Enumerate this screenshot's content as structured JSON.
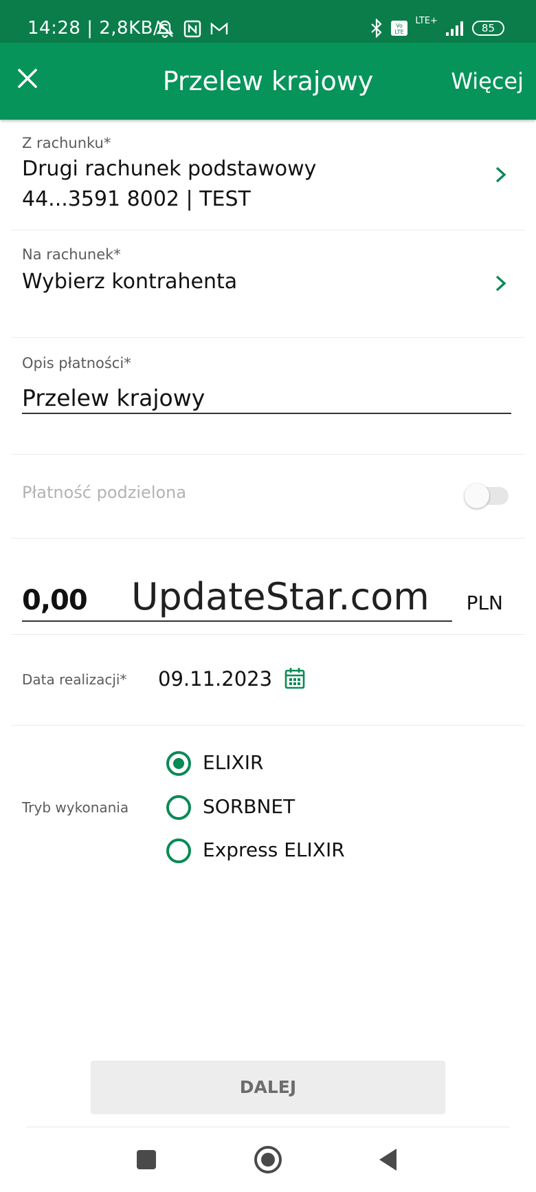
{
  "status_bar": {
    "time_speed": "14:28 | 2,8KB/s",
    "battery": "85",
    "network": "LTE+"
  },
  "app_bar": {
    "title": "Przelew krajowy",
    "more_label": "Więcej"
  },
  "from_account": {
    "label": "Z rachunku*",
    "name": "Drugi rachunek podstawowy",
    "number": "44...3591 8002 | TEST"
  },
  "to_account": {
    "label": "Na rachunek*",
    "value": "Wybierz kontrahenta"
  },
  "description": {
    "label": "Opis płatności*",
    "value": "Przelew krajowy"
  },
  "split_payment": {
    "label": "Płatność podzielona",
    "enabled": false
  },
  "amount": {
    "value": "0,00",
    "watermark": "UpdateStar.com",
    "currency": "PLN"
  },
  "execution_date": {
    "label": "Data realizacji*",
    "value": "09.11.2023"
  },
  "transfer_mode": {
    "label": "Tryb wykonania",
    "options": [
      {
        "label": "ELIXIR",
        "selected": true
      },
      {
        "label": "SORBNET",
        "selected": false
      },
      {
        "label": "Express ELIXIR",
        "selected": false
      }
    ]
  },
  "next_button": {
    "label": "DALEJ"
  },
  "colors": {
    "status_bar": "#0a7d4b",
    "app_bar": "#06945a",
    "accent": "#0a8a55"
  }
}
